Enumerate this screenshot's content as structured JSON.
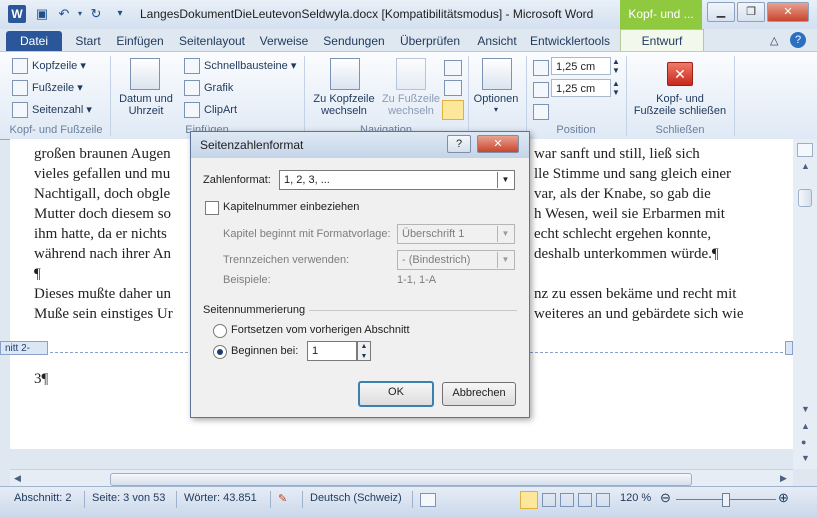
{
  "window": {
    "title": "LangesDokumentDieLeutevonSeldwyla.docx [Kompatibilitätsmodus] - Microsoft Word",
    "contextual_tab_title": "Kopf- und ...",
    "app_icon": "W"
  },
  "tabs": [
    "Datei",
    "Start",
    "Einfügen",
    "Seitenlayout",
    "Verweise",
    "Sendungen",
    "Überprüfen",
    "Ansicht",
    "Entwicklertools",
    "Entwurf"
  ],
  "ribbon": {
    "kopf_fuss": {
      "label": "Kopf- und Fußzeile",
      "items": [
        "Kopfzeile",
        "Fußzeile",
        "Seitenzahl"
      ]
    },
    "einfuegen": {
      "label": "Einfügen",
      "datum_uhrzeit": [
        "Datum und",
        "Uhrzeit"
      ],
      "items": [
        "Schnellbausteine",
        "Grafik",
        "ClipArt"
      ]
    },
    "navigation": {
      "label": "Navigation",
      "zu_kopfzeile": [
        "Zu Kopfzeile",
        "wechseln"
      ],
      "zu_fusszeile": [
        "Zu Fußzeile",
        "wechseln"
      ]
    },
    "optionen": {
      "label": "Optionen"
    },
    "position": {
      "label": "Position",
      "header_value": "1,25  cm",
      "footer_value": "1,25  cm"
    },
    "schliessen": {
      "label": "Schließen",
      "button": [
        "Kopf- und",
        "Fußzeile schließen"
      ]
    }
  },
  "document": {
    "lines": [
      "großen braunen Augen",
      "vieles gefallen und mu",
      "Nachtigall, doch obgle",
      "Mutter doch diesem so",
      "ihm hatte, da er nichts",
      "während nach ihrer An",
      "¶",
      "Dieses mußte daher un",
      "Muße sein einstiges Ur"
    ],
    "lines_right": [
      "war sanft und still, ließ sich",
      "lle Stimme und sang gleich einer",
      "var, als der Knabe, so gab die",
      "h Wesen, weil sie Erbarmen mit",
      "echt schlecht ergehen konnte,",
      "deshalb unterkommen würde.¶",
      "",
      "nz zu essen bekäme und recht mit",
      "weiteres an und gebärdete sich wie"
    ],
    "section_tag": "nitt 2-",
    "header_text": "3¶"
  },
  "dialog": {
    "title": "Seitenzahlenformat",
    "help": "?",
    "zahlenformat_label": "Zahlenformat:",
    "zahlenformat_value": "1, 2, 3, ...",
    "kapitelnummer_label": "Kapitelnummer einbeziehen",
    "kapitel_beginnt_label": "Kapitel beginnt mit Formatvorlage:",
    "kapitel_beginnt_value": "Überschrift 1",
    "trennzeichen_label": "Trennzeichen verwenden:",
    "trennzeichen_value": "-     (Bindestrich)",
    "beispiele_label": "Beispiele:",
    "beispiele_value": "1-1, 1-A",
    "seitennummerierung_label": "Seitennummerierung",
    "fortsetzen_label": "Fortsetzen vom vorherigen Abschnitt",
    "beginnen_label": "Beginnen bei:",
    "beginnen_value": "1",
    "ok": "OK",
    "abbrechen": "Abbrechen"
  },
  "status": {
    "abschnitt": "Abschnitt: 2",
    "seite": "Seite: 3 von 53",
    "woerter": "Wörter: 43.851",
    "sprache": "Deutsch (Schweiz)",
    "zoom": "120 %"
  }
}
